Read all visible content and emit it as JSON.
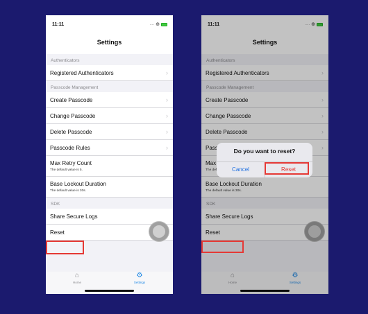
{
  "status_bar": {
    "time": "11:11",
    "signal": "...."
  },
  "nav": {
    "title": "Settings"
  },
  "sections": [
    {
      "header": "Authenticators",
      "rows": [
        {
          "label": "Registered Authenticators",
          "chevron": true
        }
      ]
    },
    {
      "header": "Passcode Management",
      "rows": [
        {
          "label": "Create Passcode",
          "chevron": true
        },
        {
          "label": "Change Passcode",
          "chevron": true
        },
        {
          "label": "Delete Passcode",
          "chevron": true
        },
        {
          "label": "Passcode Rules",
          "chevron": true
        },
        {
          "label": "Max Retry Count",
          "sub": "The default value is 5."
        },
        {
          "label": "Base Lockout Duration",
          "sub": "The default value is 30s."
        }
      ]
    },
    {
      "header": "SDK",
      "rows": [
        {
          "label": "Share Secure Logs"
        },
        {
          "label": "Reset"
        }
      ]
    }
  ],
  "tabs": [
    {
      "label": "Home",
      "icon": "home-icon",
      "active": false
    },
    {
      "label": "Settings",
      "icon": "gear-icon",
      "active": true
    }
  ],
  "alert": {
    "title": "Do you want to reset?",
    "cancel_label": "Cancel",
    "reset_label": "Reset"
  },
  "colors": {
    "background": "#1b1a6e",
    "accent_blue": "#1e88e5",
    "highlight_red": "#e53935"
  }
}
